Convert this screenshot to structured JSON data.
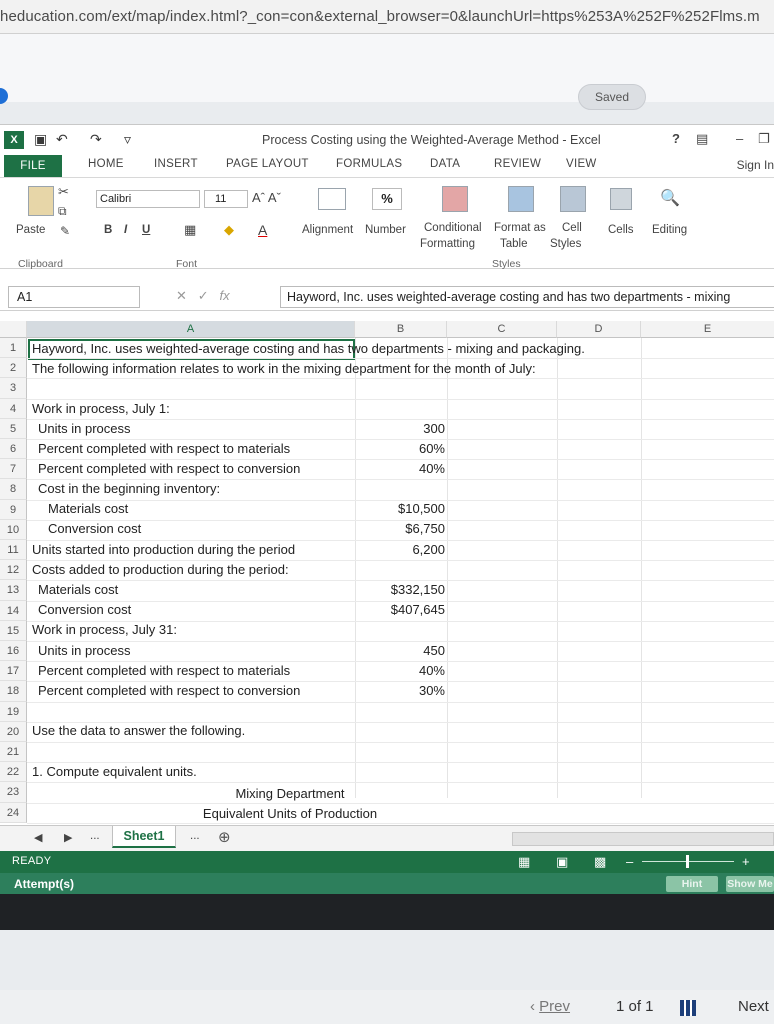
{
  "browser": {
    "url": "heducation.com/ext/map/index.html?_con=con&external_browser=0&launchUrl=https%253A%252F%252Flms.m"
  },
  "page": {
    "saved_label": "Saved"
  },
  "excel": {
    "title": "Process Costing using the Weighted-Average Method - Excel",
    "help": "?",
    "tabs": [
      "FILE",
      "HOME",
      "INSERT",
      "PAGE LAYOUT",
      "FORMULAS",
      "DATA",
      "REVIEW",
      "VIEW"
    ],
    "signin": "Sign In",
    "ribbon": {
      "paste": "Paste",
      "font_name": "Calibri",
      "font_size": "11",
      "bold": "B",
      "italic": "I",
      "underline": "U",
      "alignment": "Alignment",
      "number": "Number",
      "percent": "%",
      "conditional_formatting": [
        "Conditional",
        "Formatting"
      ],
      "format_as_table": [
        "Format as",
        "Table"
      ],
      "cell_styles": [
        "Cell",
        "Styles"
      ],
      "cells": "Cells",
      "editing": "Editing",
      "groups": {
        "clipboard": "Clipboard",
        "font": "Font",
        "styles": "Styles"
      }
    },
    "name_box": "A1",
    "formula": "Hayword, Inc. uses weighted-average costing and has two departments - mixing",
    "columns": [
      "A",
      "B",
      "C",
      "D",
      "E"
    ],
    "rows": [
      "1",
      "2",
      "3",
      "4",
      "5",
      "6",
      "7",
      "8",
      "9",
      "10",
      "11",
      "12",
      "13",
      "14",
      "15",
      "16",
      "17",
      "18",
      "19",
      "20",
      "21",
      "22",
      "23",
      "24"
    ],
    "cells": {
      "r1": "Hayword, Inc. uses weighted-average costing and has two departments - mixing and packaging.",
      "r2": "The following information relates to work in the mixing department for the month of July:",
      "r4": "Work in process, July 1:",
      "r5": "Units in process",
      "r6": "Percent completed with respect to materials",
      "r7": "Percent completed with respect to conversion",
      "r8": "Cost in the beginning inventory:",
      "r9": "Materials cost",
      "r10": "Conversion cost",
      "r11": "Units started into production during the period",
      "r12": "Costs added to production during the period:",
      "r13": "Materials cost",
      "r14": "Conversion cost",
      "r15": "Work in process, July 31:",
      "r16": "Units in process",
      "r17": "Percent completed with respect to materials",
      "r18": "Percent completed with respect to conversion",
      "r20": "Use the data to answer the following.",
      "r22": "1. Compute equivalent units.",
      "r23": "Mixing Department",
      "r24": "Equivalent Units of Production"
    },
    "values": {
      "r5": "300",
      "r6": "60%",
      "r7": "40%",
      "r9": "$10,500",
      "r10": "$6,750",
      "r11": "6,200",
      "r13": "$332,150",
      "r14": "$407,645",
      "r16": "450",
      "r17": "40%",
      "r18": "30%"
    },
    "sheet_tab": "Sheet1",
    "ellipsis": "...",
    "status": "READY"
  },
  "assignment": {
    "attempts_label": "Attempt(s)",
    "hint": "Hint",
    "show_me": "Show Me"
  },
  "footer": {
    "prev": "Prev",
    "page": "1 of 1",
    "next": "Next"
  }
}
